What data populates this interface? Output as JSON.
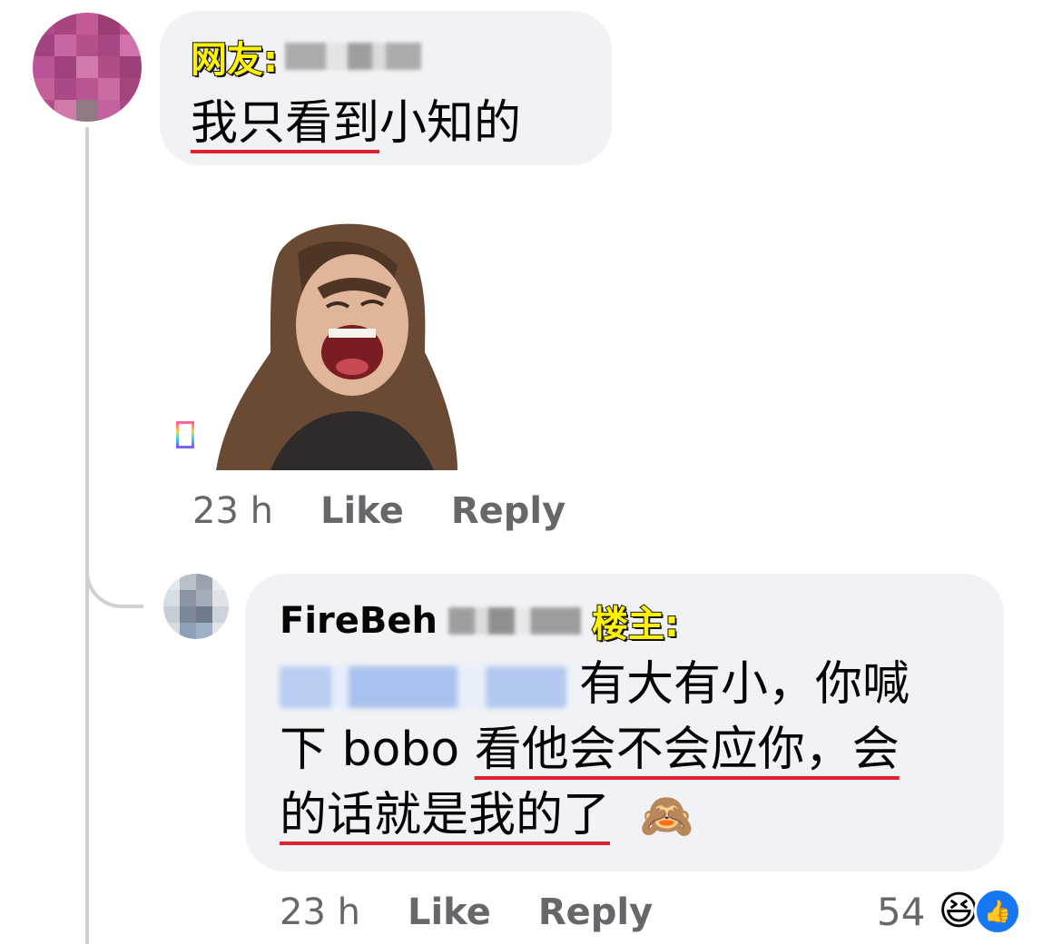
{
  "comment1": {
    "tag_label": "网友:",
    "text_underlined": "我只看到",
    "text_rest": "小知的",
    "time": "23 h",
    "like_label": "Like",
    "reply_label": "Reply"
  },
  "comment2": {
    "author": "FireBeh",
    "tag_label": "楼主:",
    "line1": "有大有小，你喊",
    "line2_plain": "下 bobo ",
    "line2_underlined": "看他会不会应你，会",
    "line3_underlined": "的话就是我的了",
    "emoji": "🙈",
    "time": "23 h",
    "like_label": "Like",
    "reply_label": "Reply",
    "reaction_count": "54",
    "reaction_laugh_emoji": "😆",
    "reaction_like_glyph": "👍"
  },
  "colors": {
    "bubble": "#f0f2f5",
    "tag_fill": "#fff200",
    "underline": "#e0202a",
    "meta_text": "#65676b",
    "like_blue": "#1877f2"
  }
}
